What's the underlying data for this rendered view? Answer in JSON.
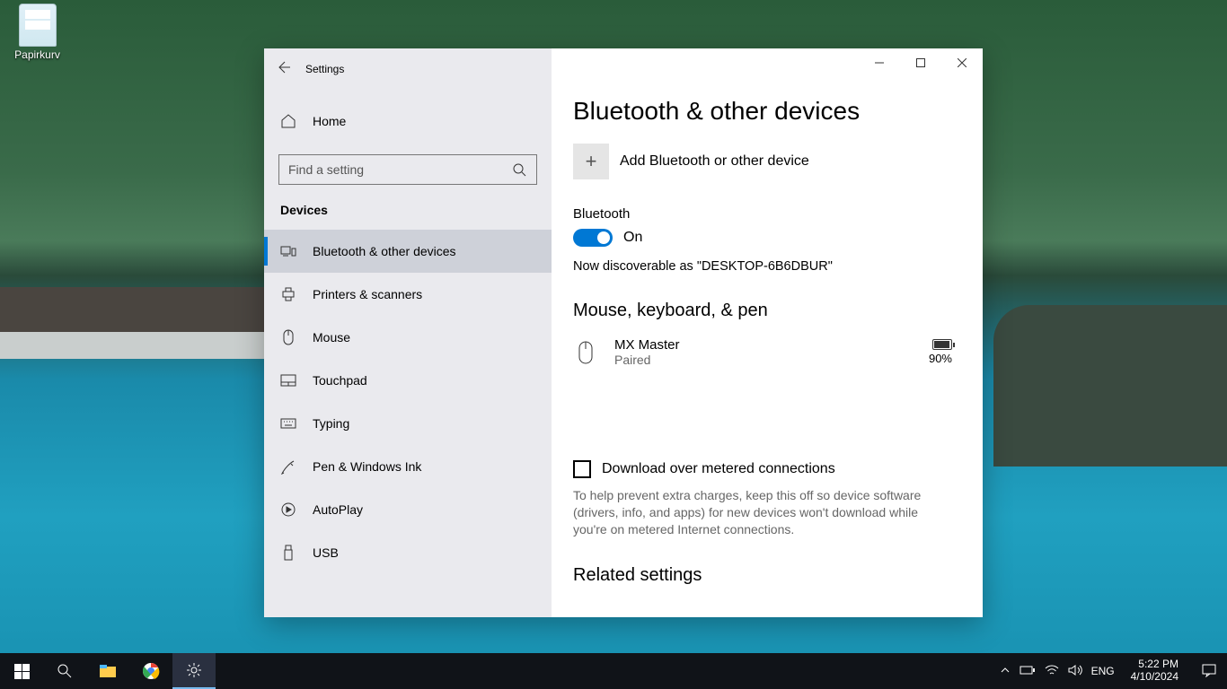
{
  "desktop": {
    "recycle_bin": "Papirkurv"
  },
  "window": {
    "title": "Settings",
    "home": "Home",
    "search_placeholder": "Find a setting",
    "section": "Devices",
    "nav": [
      "Bluetooth & other devices",
      "Printers & scanners",
      "Mouse",
      "Touchpad",
      "Typing",
      "Pen & Windows Ink",
      "AutoPlay",
      "USB"
    ]
  },
  "main": {
    "title": "Bluetooth & other devices",
    "add_device": "Add Bluetooth or other device",
    "bluetooth_label": "Bluetooth",
    "bluetooth_state": "On",
    "discoverable": "Now discoverable as \"DESKTOP-6B6DBUR\"",
    "group1": "Mouse, keyboard, & pen",
    "device": {
      "name": "MX Master",
      "status": "Paired",
      "battery": "90%"
    },
    "metered_label": "Download over metered connections",
    "metered_help": "To help prevent extra charges, keep this off so device software (drivers, info, and apps) for new devices won't download while you're on metered Internet connections.",
    "related": "Related settings"
  },
  "taskbar": {
    "lang": "ENG",
    "time": "5:22 PM",
    "date": "4/10/2024"
  }
}
